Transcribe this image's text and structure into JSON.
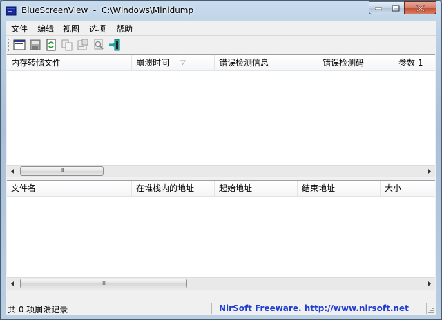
{
  "window": {
    "title": "BlueScreenView  -  C:\\Windows\\Minidump",
    "min_icon": "minimize-icon",
    "max_icon": "maximize-icon",
    "close_icon": "close-icon",
    "accent": "#c24f34"
  },
  "menu": [
    "文件",
    "编辑",
    "视图",
    "选项",
    "帮助"
  ],
  "toolbar": [
    {
      "name": "properties-icon"
    },
    {
      "name": "save-icon"
    },
    {
      "name": "refresh-icon"
    },
    {
      "name": "copy-icon"
    },
    {
      "name": "html-report-icon"
    },
    {
      "name": "find-icon"
    },
    {
      "name": "exit-icon"
    }
  ],
  "dump_list": {
    "columns": [
      "内存转储文件",
      "崩溃时间",
      "错误检测信息",
      "错误检测码",
      "参数 1"
    ],
    "sort_indicator": "sort-ascending-icon",
    "rows": []
  },
  "module_list": {
    "columns": [
      "文件名",
      "在堆栈内的地址",
      "起始地址",
      "结束地址",
      "大小"
    ],
    "rows": []
  },
  "scroll_grip": "III",
  "status": {
    "count_text": "共 0 项崩溃记录",
    "link_text": "NirSoft Freeware.  http://www.nirsoft.net",
    "link_color": "#1f3bd0"
  }
}
